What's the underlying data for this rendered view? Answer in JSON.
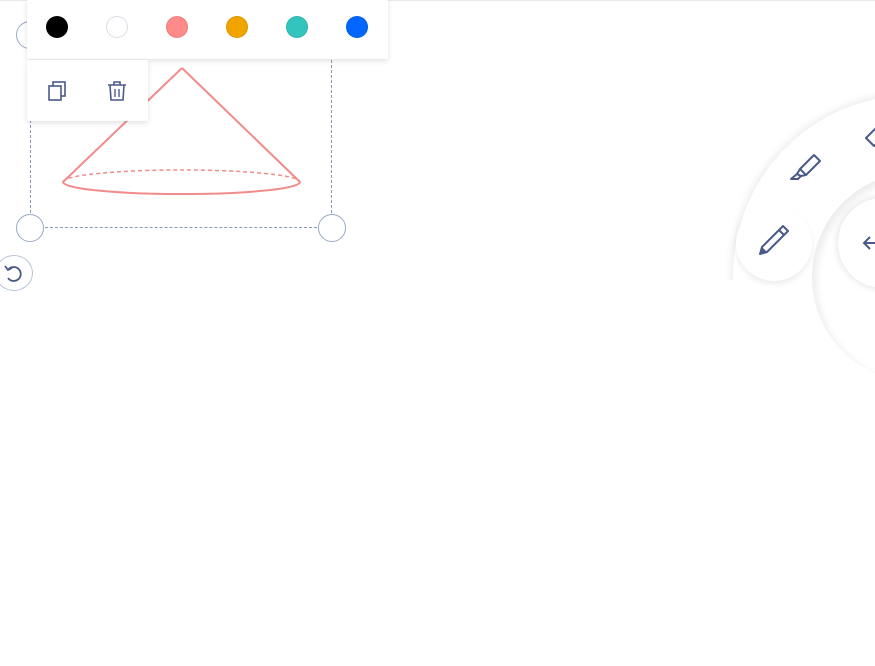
{
  "colors": {
    "stroke": "#f28b8b",
    "selection": "#8a9ab6",
    "icon": "#4a5a88"
  },
  "palette": {
    "swatches": [
      {
        "name": "black",
        "color": "#000000"
      },
      {
        "name": "white",
        "color": "#ffffff"
      },
      {
        "name": "salmon",
        "color": "#ff8a8a"
      },
      {
        "name": "orange",
        "color": "#f0a400"
      },
      {
        "name": "teal",
        "color": "#33c4bd"
      },
      {
        "name": "blue",
        "color": "#0066ff"
      }
    ]
  },
  "actions": {
    "icons": [
      "duplicate-icon",
      "trash-icon"
    ]
  },
  "radial_menu": {
    "tools": [
      "highlighter-icon",
      "pencil-icon",
      "eraser-icon",
      "back-arrow-icon"
    ]
  },
  "shape": {
    "type": "cone"
  }
}
